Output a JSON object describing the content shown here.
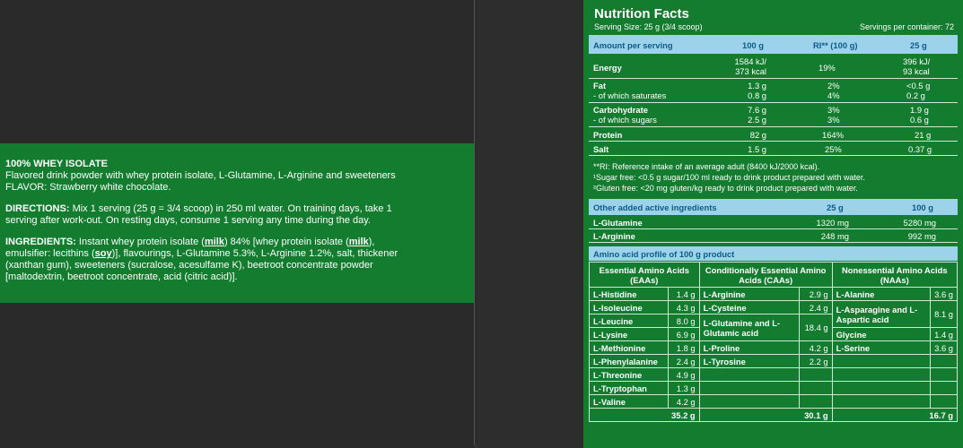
{
  "left": {
    "title": "100% WHEY ISOLATE",
    "desc": "Flavored drink powder with whey protein isolate, L-Glutamine, L-Arginine and sweeteners",
    "flavor": "FLAVOR: Strawberry white chocolate.",
    "directions_label": "DIRECTIONS:",
    "directions": "Mix 1 serving (25 g = 3/4 scoop) in 250 ml water. On training days, take 1 serving after work-out. On resting days, consume 1 serving any time during the day.",
    "ingredients_label": "INGREDIENTS:",
    "ing1": "Instant whey protein isolate (",
    "milk1": "milk",
    "ing2": ") 84% [whey protein isolate (",
    "milk2": "milk",
    "ing3": "), emulsifier: lecithins (",
    "soy": "soy",
    "ing4": ")], flavourings, L-Glutamine 5.3%, L-Arginine 1.2%, salt, thickener (xanthan gum), sweeteners (sucralose, acesulfame K), beetroot concentrate powder [maltodextrin, beetroot concentrate, acid (citric acid)]."
  },
  "facts": {
    "title": "Nutrition Facts",
    "serving_size": "Serving Size: 25 g (3/4 scoop)",
    "servings_per_container": "Servings per container: 72",
    "header": [
      "Amount per serving",
      "100 g",
      "RI** (100 g)",
      "25 g"
    ],
    "rows": [
      {
        "name": "Energy",
        "sub": "",
        "a": "1584 kJ/",
        "a2": "373 kcal",
        "b": "19%",
        "c": "396 kJ/",
        "c2": "93 kcal"
      },
      {
        "name": "Fat",
        "sub": "- of which saturates",
        "a": "1.3 g",
        "a2": "0.8 g",
        "b": "2%",
        "b2": "4%",
        "c": "<0.5 g",
        "c2": "0.2 g"
      },
      {
        "name": "Carbohydrate",
        "sub": "- of which sugars",
        "a": "7.6 g",
        "a2": "2.5 g",
        "b": "3%",
        "b2": "3%",
        "c": "1.9 g",
        "c2": "0.6 g"
      },
      {
        "name": "Protein",
        "a": "82 g",
        "b": "164%",
        "c": "21 g"
      },
      {
        "name": "Salt",
        "a": "1.5 g",
        "b": "25%",
        "c": "0.37 g"
      }
    ],
    "notes": [
      "**RI: Reference intake of an average adult (8400 kJ/2000 kcal).",
      "¹Sugar free: <0.5 g sugar/100 ml ready to drink product prepared with water.",
      "²Gluten free: <20 mg gluten/kg ready to drink product prepared with water."
    ],
    "other_header": [
      "Other added active ingredients",
      "25 g",
      "100 g"
    ],
    "other_rows": [
      {
        "name": "L-Glutamine",
        "a": "1320 mg",
        "b": "5280 mg"
      },
      {
        "name": "L-Arginine",
        "a": "248 mg",
        "b": "992 mg"
      }
    ],
    "amino_header": "Amino acid profile of 100 g product",
    "amino_cols": [
      "Essential Amino Acids (EAAs)",
      "Conditionally Essential Amino Acids (CAAs)",
      "Nonessential Amino Acids (NAAs)"
    ],
    "eaa": [
      [
        "L-Histidine",
        "1.4 g"
      ],
      [
        "L-Isoleucine",
        "4.3 g"
      ],
      [
        "L-Leucine",
        "8.0 g"
      ],
      [
        "L-Lysine",
        "6.9 g"
      ],
      [
        "L-Methionine",
        "1.8 g"
      ],
      [
        "L-Phenylalanine",
        "2.4 g"
      ],
      [
        "L-Threonine",
        "4.9 g"
      ],
      [
        "L-Tryptophan",
        "1.3 g"
      ],
      [
        "L-Valine",
        "4.2 g"
      ]
    ],
    "caa": [
      [
        "L-Arginine",
        "2.9 g"
      ],
      [
        "L-Cysteine",
        "2.4 g"
      ],
      [
        "L-Glutamine and L-Glutamic acid",
        "18.4 g"
      ],
      [
        "L-Proline",
        "4.2 g"
      ],
      [
        "L-Tyrosine",
        "2.2 g"
      ]
    ],
    "naa": [
      [
        "L-Alanine",
        "3.6 g"
      ],
      [
        "L-Asparagine and L-Aspartic acid",
        "8.1 g"
      ],
      [
        "Glycine",
        "1.4 g"
      ],
      [
        "L-Serine",
        "3.6 g"
      ]
    ],
    "totals": [
      "35.2 g",
      "30.1 g",
      "16.7 g"
    ]
  }
}
